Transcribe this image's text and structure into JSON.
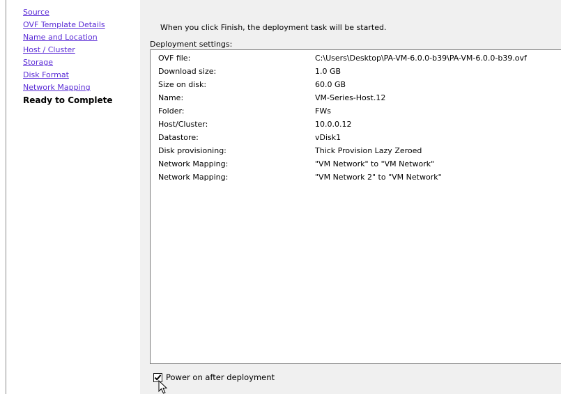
{
  "nav": {
    "items": [
      {
        "label": "Source"
      },
      {
        "label": "OVF Template Details"
      },
      {
        "label": "Name and Location"
      },
      {
        "label": "Host / Cluster"
      },
      {
        "label": "Storage"
      },
      {
        "label": "Disk Format"
      },
      {
        "label": "Network Mapping"
      },
      {
        "label": "Ready to Complete"
      }
    ],
    "current": "Ready to Complete"
  },
  "main": {
    "intro": "When you click Finish, the deployment task will be started.",
    "settings_label": "Deployment settings:",
    "settings": [
      {
        "key": "OVF file:",
        "value": "C:\\Users\\Desktop\\PA-VM-6.0.0-b39\\PA-VM-6.0.0-b39.ovf"
      },
      {
        "key": "Download size:",
        "value": "1.0 GB"
      },
      {
        "key": "Size on disk:",
        "value": "60.0 GB"
      },
      {
        "key": "Name:",
        "value": "VM-Series-Host.12"
      },
      {
        "key": "Folder:",
        "value": "FWs"
      },
      {
        "key": "Host/Cluster:",
        "value": "10.0.0.12"
      },
      {
        "key": "Datastore:",
        "value": "vDisk1"
      },
      {
        "key": "Disk provisioning:",
        "value": "Thick Provision Lazy Zeroed"
      },
      {
        "key": "Network Mapping:",
        "value": "\"VM Network\" to \"VM Network\""
      },
      {
        "key": "Network Mapping:",
        "value": "\"VM Network 2\" to \"VM Network\""
      }
    ],
    "power_on": {
      "label": "Power on after deployment",
      "checked": true
    }
  },
  "icons": {
    "checkbox": "checkmark-icon",
    "cursor": "mouse-pointer-icon"
  }
}
